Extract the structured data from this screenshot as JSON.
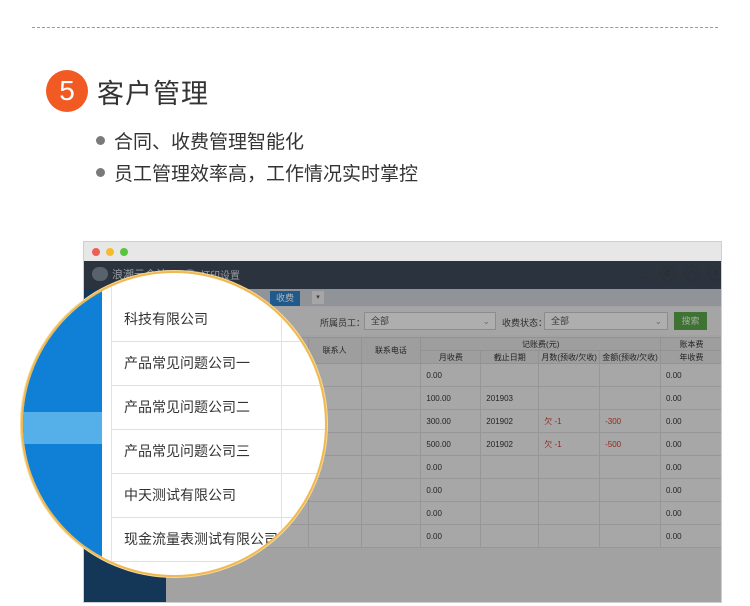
{
  "section": {
    "number": "5",
    "title": "客户管理",
    "bullets": [
      "合同、收费管理智能化",
      "员工管理效率高，工作情况实时掌控"
    ]
  },
  "app": {
    "logo_text": "浪潮云会计",
    "tab_label": "打印设置",
    "subtab_active": "收费",
    "subtab_more": "▾"
  },
  "filters": {
    "staff_label": "所属员工：",
    "staff_value": "全部",
    "status_label": "收费状态：",
    "status_value": "全部",
    "search_button": "搜索"
  },
  "table": {
    "group_header": "记账费(元)",
    "group_header_right": "账本费",
    "columns": [
      "联系人",
      "联系电话",
      "月收费",
      "截止日期",
      "月数(预收/欠收)",
      "金额(预收/欠收)",
      "年收费"
    ],
    "rows": [
      {
        "monthly": "0.00",
        "end_date": "",
        "months": "",
        "amount": "",
        "annual": "0.00"
      },
      {
        "monthly": "100.00",
        "end_date": "201903",
        "months": "",
        "amount": "",
        "annual": "0.00"
      },
      {
        "monthly": "300.00",
        "end_date": "201902",
        "months": "欠 -1",
        "amount": "-300",
        "annual": "0.00"
      },
      {
        "monthly": "500.00",
        "end_date": "201902",
        "months": "欠 -1",
        "amount": "-500",
        "annual": "0.00"
      },
      {
        "monthly": "0.00",
        "end_date": "",
        "months": "",
        "amount": "",
        "annual": "0.00"
      },
      {
        "monthly": "0.00",
        "end_date": "",
        "months": "",
        "amount": "",
        "annual": "0.00"
      },
      {
        "monthly": "0.00",
        "end_date": "",
        "months": "",
        "amount": "",
        "annual": "0.00"
      },
      {
        "monthly": "0.00",
        "end_date": "",
        "months": "",
        "amount": "",
        "annual": "0.00"
      }
    ]
  },
  "magnifier": {
    "companies": [
      "科技有限公司",
      "产品常见问题公司一",
      "产品常见问题公司二",
      "产品常见问题公司三",
      "中天测试有限公司",
      "现金流量表测试有限公司"
    ]
  },
  "colors": {
    "accent": "#f15a22",
    "sidebar_blue": "#0f80d5",
    "magnifier_ring": "#f0b94f",
    "search_green": "#5aa54a"
  }
}
